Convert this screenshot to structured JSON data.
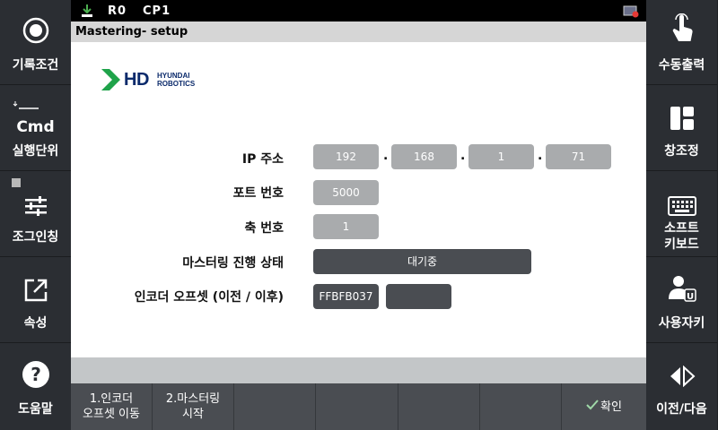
{
  "left_sidebar": {
    "items": [
      {
        "label": "기록조건",
        "icon": "record-circle-icon"
      },
      {
        "label": "실행단위",
        "icon": "cmd-icon",
        "icon_text": "Cmd"
      },
      {
        "label": "조그인칭",
        "icon": "sliders-icon"
      },
      {
        "label": "속성",
        "icon": "external-link-icon"
      },
      {
        "label": "도움말",
        "icon": "help-icon"
      }
    ]
  },
  "right_sidebar": {
    "items": [
      {
        "label": "수동출력",
        "icon": "touch-hand-icon"
      },
      {
        "label": "창조정",
        "icon": "window-layout-icon"
      },
      {
        "label_line1": "소프트",
        "label_line2": "키보드",
        "icon": "keyboard-icon"
      },
      {
        "label": "사용자키",
        "icon": "user-key-icon"
      },
      {
        "label": "이전/다음",
        "icon": "prev-next-icon"
      }
    ]
  },
  "topbar": {
    "robot": "R0",
    "program": "CP1"
  },
  "title": "Mastering- setup",
  "logo": {
    "brand": "HD",
    "line1": "HYUNDAI",
    "line2": "ROBOTICS"
  },
  "form": {
    "ip_label": "IP 주소",
    "ip": [
      "192",
      "168",
      "1",
      "71"
    ],
    "dot": ".",
    "port_label": "포트 번호",
    "port_value": "5000",
    "axis_label": "축 번호",
    "axis_value": "1",
    "progress_label": "마스터링 진행 상태",
    "progress_value": "대기중",
    "offset_label": "인코더 오프셋 (이전 / 이후)",
    "offset_before": "FFBFB037",
    "offset_after": ""
  },
  "function_keys": [
    {
      "line1": "1.인코더",
      "line2": "오프셋 이동"
    },
    {
      "line1": "2.마스터링",
      "line2": "시작"
    },
    {
      "line1": "",
      "line2": ""
    },
    {
      "line1": "",
      "line2": ""
    },
    {
      "line1": "",
      "line2": ""
    },
    {
      "line1": "",
      "line2": ""
    },
    {
      "line1": "확인",
      "line2": ""
    }
  ],
  "colors": {
    "accent_logo": "#1fa34a",
    "logo_text": "#0b2a6b",
    "field_bg": "#a9abad",
    "field_dark": "#4a4d52"
  }
}
